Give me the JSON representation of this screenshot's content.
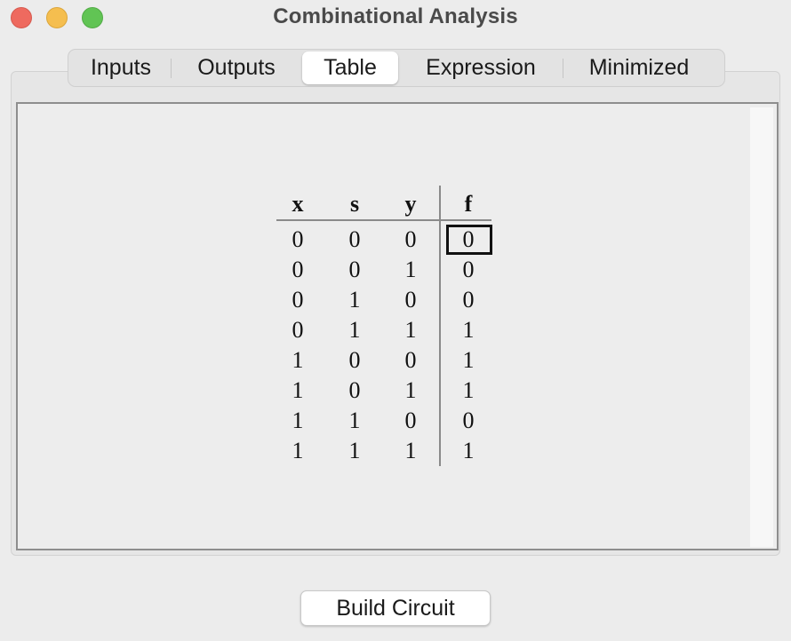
{
  "window": {
    "title": "Combinational Analysis"
  },
  "tabs": [
    {
      "label": "Inputs",
      "active": false
    },
    {
      "label": "Outputs",
      "active": false
    },
    {
      "label": "Table",
      "active": true
    },
    {
      "label": "Expression",
      "active": false
    },
    {
      "label": "Minimized",
      "active": false
    }
  ],
  "table": {
    "inputs": [
      "x",
      "s",
      "y"
    ],
    "output": "f",
    "rows": [
      [
        "0",
        "0",
        "0",
        "0"
      ],
      [
        "0",
        "0",
        "1",
        "0"
      ],
      [
        "0",
        "1",
        "0",
        "0"
      ],
      [
        "0",
        "1",
        "1",
        "1"
      ],
      [
        "1",
        "0",
        "0",
        "1"
      ],
      [
        "1",
        "0",
        "1",
        "1"
      ],
      [
        "1",
        "1",
        "0",
        "0"
      ],
      [
        "1",
        "1",
        "1",
        "1"
      ]
    ],
    "selected_row": 0
  },
  "footer": {
    "build_label": "Build Circuit"
  },
  "colors": {
    "close": "#ee6a5f",
    "minimize": "#f5be4f",
    "maximize": "#61c454"
  }
}
